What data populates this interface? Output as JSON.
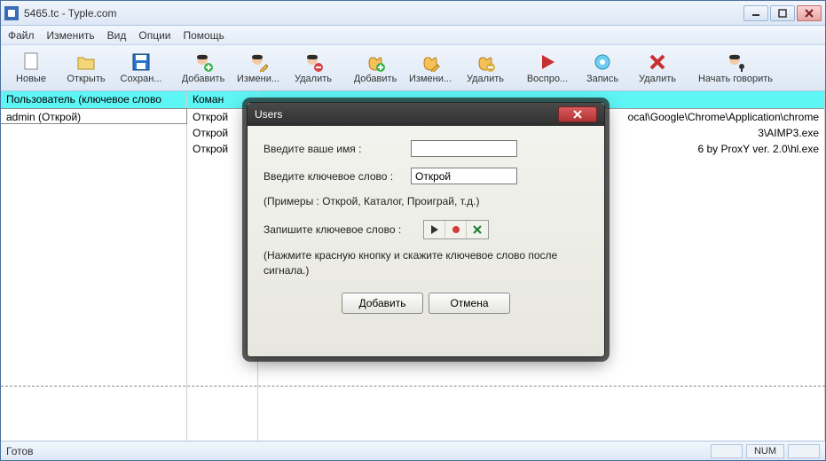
{
  "window": {
    "title": "5465.tc - Typle.com"
  },
  "menu": {
    "file": "Файл",
    "edit": "Изменить",
    "view": "Вид",
    "options": "Опции",
    "help": "Помощь"
  },
  "toolbar": {
    "new": "Новые",
    "open": "Открыть",
    "save": "Сохран...",
    "user_add": "Добавить",
    "user_edit": "Измени...",
    "user_delete": "Удалить",
    "cmd_add": "Добавить",
    "cmd_edit": "Измени...",
    "cmd_delete": "Удалить",
    "play": "Воспро...",
    "record": "Запись",
    "rec_delete": "Удалить",
    "start_speaking": "Начать говорить"
  },
  "columns": {
    "user": "Пользователь (ключевое слово",
    "command": "Коман",
    "path": " "
  },
  "rows": {
    "user0": "admin (Открой)",
    "cmd0": "Открой",
    "cmd1": "Открой",
    "cmd2": "Открой",
    "path0": "ocal\\Google\\Chrome\\Application\\chrome",
    "path1": "3\\AIMP3.exe",
    "path2": "6 by ProxY ver. 2.0\\hl.exe"
  },
  "dialog": {
    "title": "Users",
    "name_label": "Введите ваше имя :",
    "name_value": "",
    "keyword_label": "Введите ключевое слово :",
    "keyword_value": "Открой",
    "examples": "(Примеры : Открой, Каталог, Проиграй, т.д.)",
    "record_label": "Запишите ключевое слово :",
    "hint": "(Нажмите красную кнопку и скажите ключевое слово после сигнала.)",
    "add": "Добавить",
    "cancel": "Отмена"
  },
  "status": {
    "text": "Готов",
    "num": "NUM"
  }
}
